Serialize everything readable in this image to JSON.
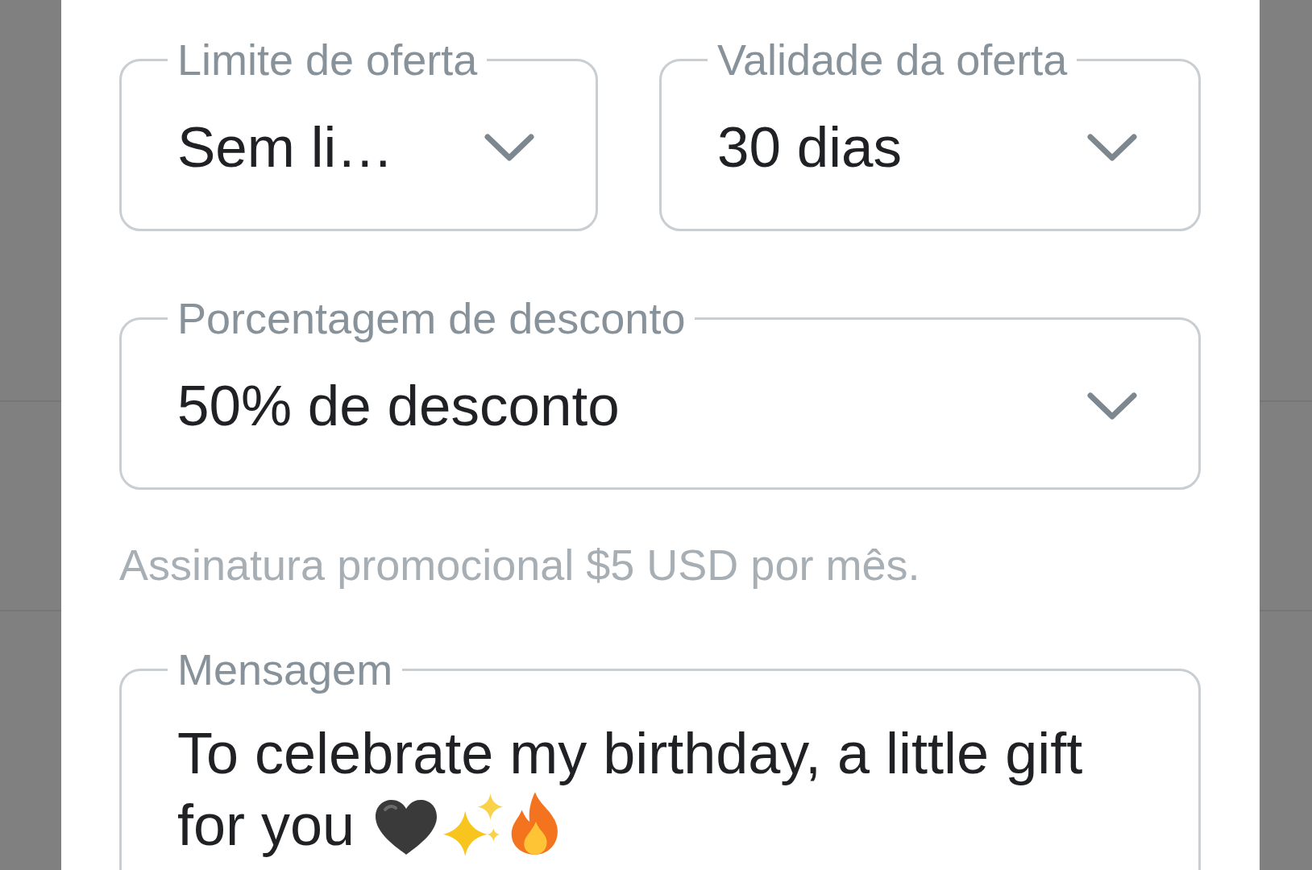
{
  "offer_fields": [
    {
      "label": "Limite de oferta",
      "value": "Sem li…"
    },
    {
      "label": "Validade da oferta",
      "value": "30 dias"
    }
  ],
  "discount_field": {
    "label": "Porcentagem de desconto",
    "value": "50% de desconto"
  },
  "helper_text": "Assinatura promocional $5 USD por mês.",
  "message_field": {
    "label": "Mensagem",
    "value": "To celebrate my birthday, a little gift for you"
  }
}
